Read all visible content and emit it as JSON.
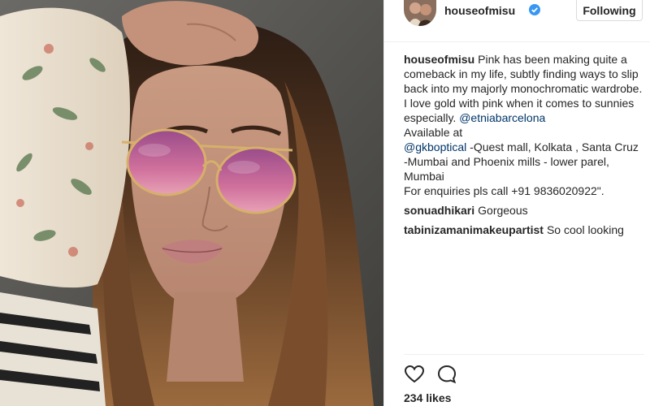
{
  "header": {
    "username": "houseofmisu",
    "follow_label": "Following"
  },
  "caption": {
    "username": "houseofmisu",
    "text_a": "Pink has been making quite a comeback in my life, subtly finding ways to slip back into my majorly monochromatic wardrobe. I love gold with pink when it comes to sunnies especially. ",
    "tag_1": "@etniabarcelona",
    "text_b": "\nAvailable at\n",
    "tag_2": "@gkboptical",
    "text_c": " -Quest mall, Kolkata , Santa Cruz -Mumbai and Phoenix mills - lower parel, Mumbai\nFor enquiries pls call +91 9836020922\"."
  },
  "comments": [
    {
      "username": "sonuadhikari",
      "text": "Gorgeous"
    },
    {
      "username": "tabinizamanimakeupartist",
      "text": "So cool looking"
    }
  ],
  "actions": {
    "like_icon": "heart-icon",
    "comment_icon": "comment-icon"
  },
  "likes": "234 likes",
  "colors": {
    "text": "#262626",
    "link": "#003569",
    "verified": "#3897f0",
    "border": "#efefef"
  }
}
